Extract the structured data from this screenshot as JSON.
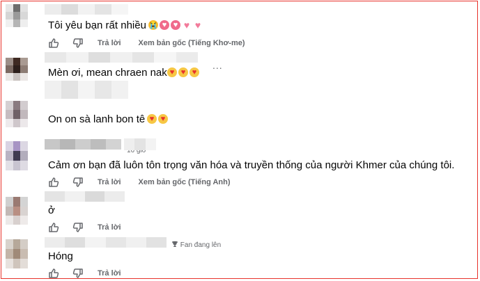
{
  "colors": {
    "border": "#e8322b",
    "text": "#050505",
    "muted": "#65676b"
  },
  "actions": {
    "like_icon": "thumbs-up-icon",
    "dislike_icon": "thumbs-down-icon",
    "reply_label": "Trả lời"
  },
  "comments": [
    {
      "text": "Tôi yêu bạn rất nhiều",
      "emojis": [
        "crying-face",
        "heart-ribbon",
        "heart-ribbon",
        "heart",
        "heart"
      ],
      "see_original": "Xem bản gốc (Tiếng Khơ-me)"
    },
    {
      "text": "Mèn ơi, mean chraen nak",
      "emojis": [
        "smiling-face-with-hearts",
        "smiling-face-with-hearts",
        "smiling-face-with-hearts"
      ],
      "more": "..."
    },
    {
      "text": "On on sà lanh bon tê",
      "emojis": [
        "face-blowing-kiss",
        "face-blowing-kiss"
      ]
    },
    {
      "text": "Cảm ơn bạn đã luôn tôn trọng văn hóa và truyền thống của người Khmer của chúng tôi.",
      "see_original": "Xem bản gốc (Tiếng Anh)",
      "timestamp": "16 giờ"
    },
    {
      "text": "ở"
    },
    {
      "text": "Hóng",
      "badge": "Fan đang lên",
      "badge_icon": "trophy-icon"
    }
  ]
}
